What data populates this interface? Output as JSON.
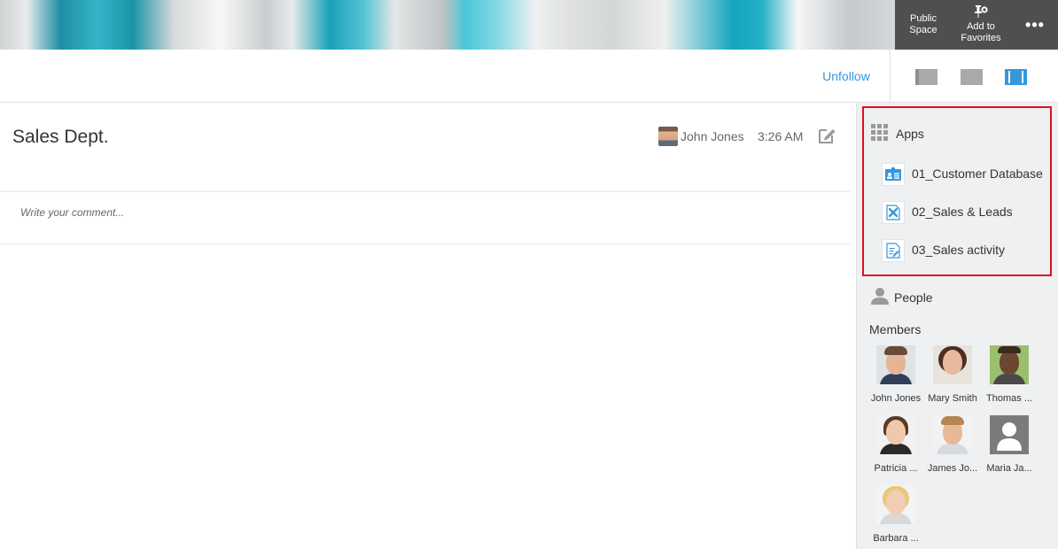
{
  "header": {
    "public_space": "Public Space",
    "add_to_favorites": "Add to Favorites",
    "more": "•••"
  },
  "toolbar": {
    "unfollow": "Unfollow",
    "active_layout": 3
  },
  "thread": {
    "title": "Sales Dept.",
    "author": "John Jones",
    "time": "3:26 AM",
    "comment_placeholder": "Write your comment..."
  },
  "sidebar": {
    "apps_title": "Apps",
    "apps": [
      {
        "label": "01_Customer Database",
        "icon": "contact-card-icon"
      },
      {
        "label": "02_Sales & Leads",
        "icon": "tools-document-icon"
      },
      {
        "label": "03_Sales activity",
        "icon": "edit-document-icon"
      }
    ],
    "people_title": "People",
    "members_title": "Members",
    "members": [
      {
        "name": "John Jones"
      },
      {
        "name": "Mary Smith"
      },
      {
        "name": "Thomas ..."
      },
      {
        "name": "Patricia ..."
      },
      {
        "name": "James Jo..."
      },
      {
        "name": "Maria Ja..."
      },
      {
        "name": "Barbara ..."
      }
    ]
  },
  "colors": {
    "accent": "#3498db",
    "highlight_border": "#e0101c",
    "sidebar_bg": "#eef0f1"
  }
}
